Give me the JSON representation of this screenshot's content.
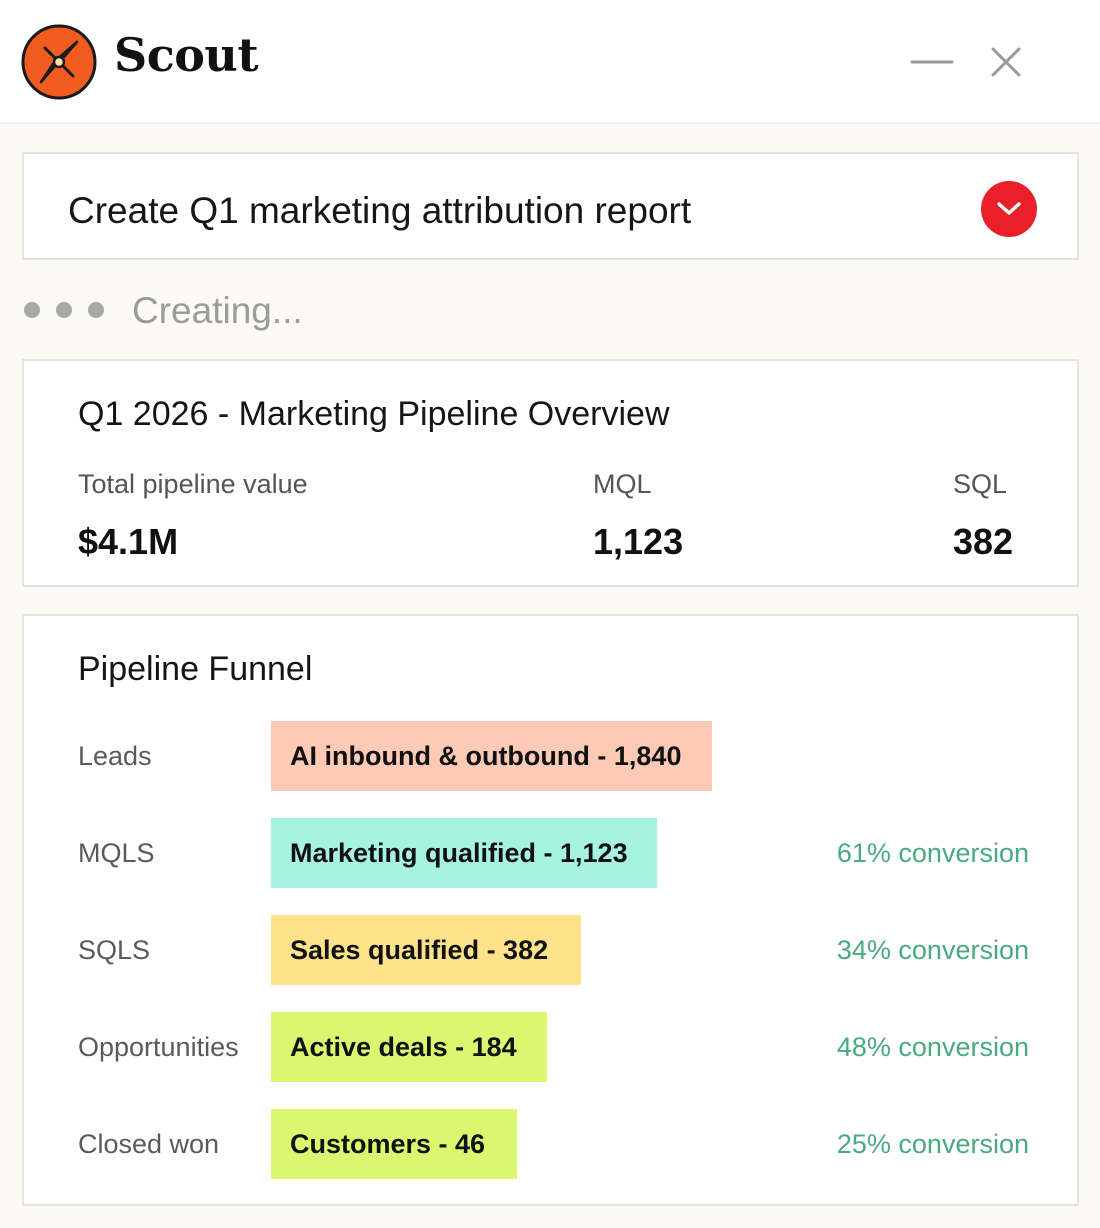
{
  "app": {
    "title": "Scout",
    "colors": {
      "accent": "#e9202a",
      "logo_orange": "#f25c1f"
    }
  },
  "prompt": {
    "text": "Create Q1 marketing attribution report",
    "toggle_icon": "chevron-down-icon"
  },
  "status": {
    "text": "Creating..."
  },
  "overview": {
    "title": "Q1 2026 - Marketing Pipeline Overview",
    "metrics": [
      {
        "label": "Total pipeline value",
        "value": "$4.1M"
      },
      {
        "label": "MQL",
        "value": "1,123"
      },
      {
        "label": "SQL",
        "value": "382"
      }
    ]
  },
  "funnel": {
    "title": "Pipeline Funnel",
    "rows": [
      {
        "label": "Leads",
        "bar_text": "AI inbound & outbound - 1,840",
        "count": 1840,
        "conversion": "",
        "color": "#fdcbb5"
      },
      {
        "label": "MQLS",
        "bar_text": "Marketing qualified - 1,123",
        "count": 1123,
        "conversion": "61% conversion",
        "color": "#a5f3e0"
      },
      {
        "label": "SQLS",
        "bar_text": "Sales qualified - 382",
        "count": 382,
        "conversion": "34% conversion",
        "color": "#fde28a"
      },
      {
        "label": "Opportunities",
        "bar_text": "Active deals - 184",
        "count": 184,
        "conversion": "48% conversion",
        "color": "#d9f86f"
      },
      {
        "label": "Closed won",
        "bar_text": "Customers - 46",
        "count": 46,
        "conversion": "25% conversion",
        "color": "#d9f86f"
      }
    ]
  }
}
